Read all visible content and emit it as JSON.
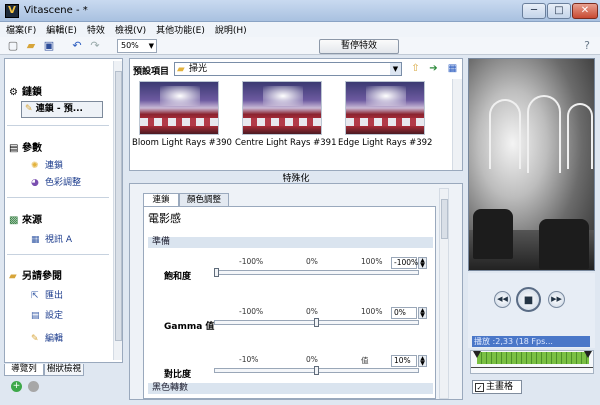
{
  "window": {
    "title": "Vitascene - *",
    "app_icon_letter": "V",
    "min": "─",
    "max": "□",
    "close": "✕"
  },
  "menu": [
    "檔案(F)",
    "編輯(E)",
    "特效",
    "檢視(V)",
    "其他功能(E)",
    "說明(H)"
  ],
  "toolbar": {
    "zoom": "50%",
    "pause_effects": "暫停特效"
  },
  "left_panel": {
    "chain_section": "鏈鎖",
    "chain_button": "連鎖 - 預...",
    "params_section": "參數",
    "params_items": [
      "連鎖",
      "色彩調整"
    ],
    "source_section": "來源",
    "source_items": [
      "視訊 A"
    ],
    "other_section": "另請參閱",
    "other_items": [
      "匯出",
      "設定",
      "編輯"
    ],
    "tabs": [
      "導覽列",
      "樹狀檢視"
    ]
  },
  "presets": {
    "label": "預設項目",
    "selected": "掃光",
    "items": [
      "Bloom Light Rays #390",
      "Centre Light Rays #391",
      "Edge Light Rays #392"
    ]
  },
  "special_label": "特殊化",
  "settings": {
    "tabs": [
      "連鎖",
      "顏色調整"
    ],
    "effect_title": "電影感",
    "group_prepare": "準備",
    "group_black": "黑色轉數",
    "params": [
      {
        "label": "飽和度",
        "min": "-100%",
        "mid": "0%",
        "max": "100%",
        "value": "-100%",
        "fraction": 0.0
      },
      {
        "label": "Gamma 值",
        "min": "-100%",
        "mid": "0%",
        "max": "100%",
        "value": "0%",
        "fraction": 0.5
      },
      {
        "label": "對比度",
        "min": "-10%",
        "mid": "0%",
        "max": "值",
        "value": "10%",
        "fraction": 0.5
      }
    ]
  },
  "playback": {
    "timecode": "播放 :2,33 (18 Fps...",
    "main_frame": "主畫格"
  },
  "colors": {
    "accent": "#4a77c8",
    "timeline_green": "#7ac043"
  }
}
